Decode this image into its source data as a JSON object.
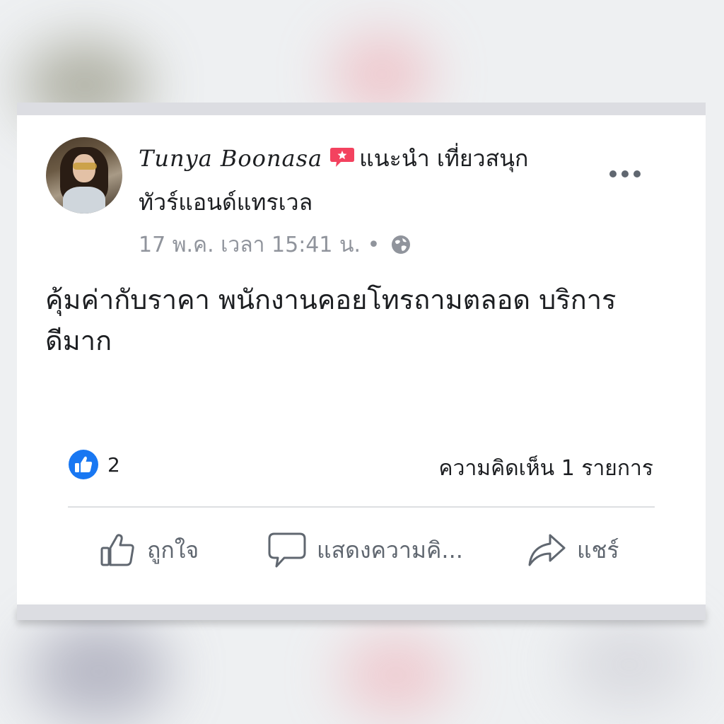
{
  "post": {
    "author": "Tunya Boonasa",
    "recommend_text": "แนะนำ เที่ยวสนุก",
    "page_name": "ทัวร์แอนด์แทรเวล",
    "timestamp": "17 พ.ค. เวลา 15:41 น. •",
    "body_line1": "คุ้มค่ากับราคา พนักงานคอยโทรถามตลอด บริการ",
    "body_line2": "ดีมาก",
    "like_count": "2",
    "comment_count": "ความคิดเห็น 1 รายการ"
  },
  "actions": {
    "like_label": "ถูกใจ",
    "comment_label": "แสดงความคิ...",
    "share_label": "แชร์"
  },
  "colors": {
    "like_blue": "#1877f2",
    "recommend_red": "#f3425f",
    "text": "#1c1e21",
    "muted": "#90949c"
  },
  "icons": {
    "more": "more-horizontal-icon",
    "globe": "globe-icon",
    "like": "thumbs-up-icon",
    "comment": "comment-bubble-icon",
    "share": "share-arrow-icon"
  }
}
